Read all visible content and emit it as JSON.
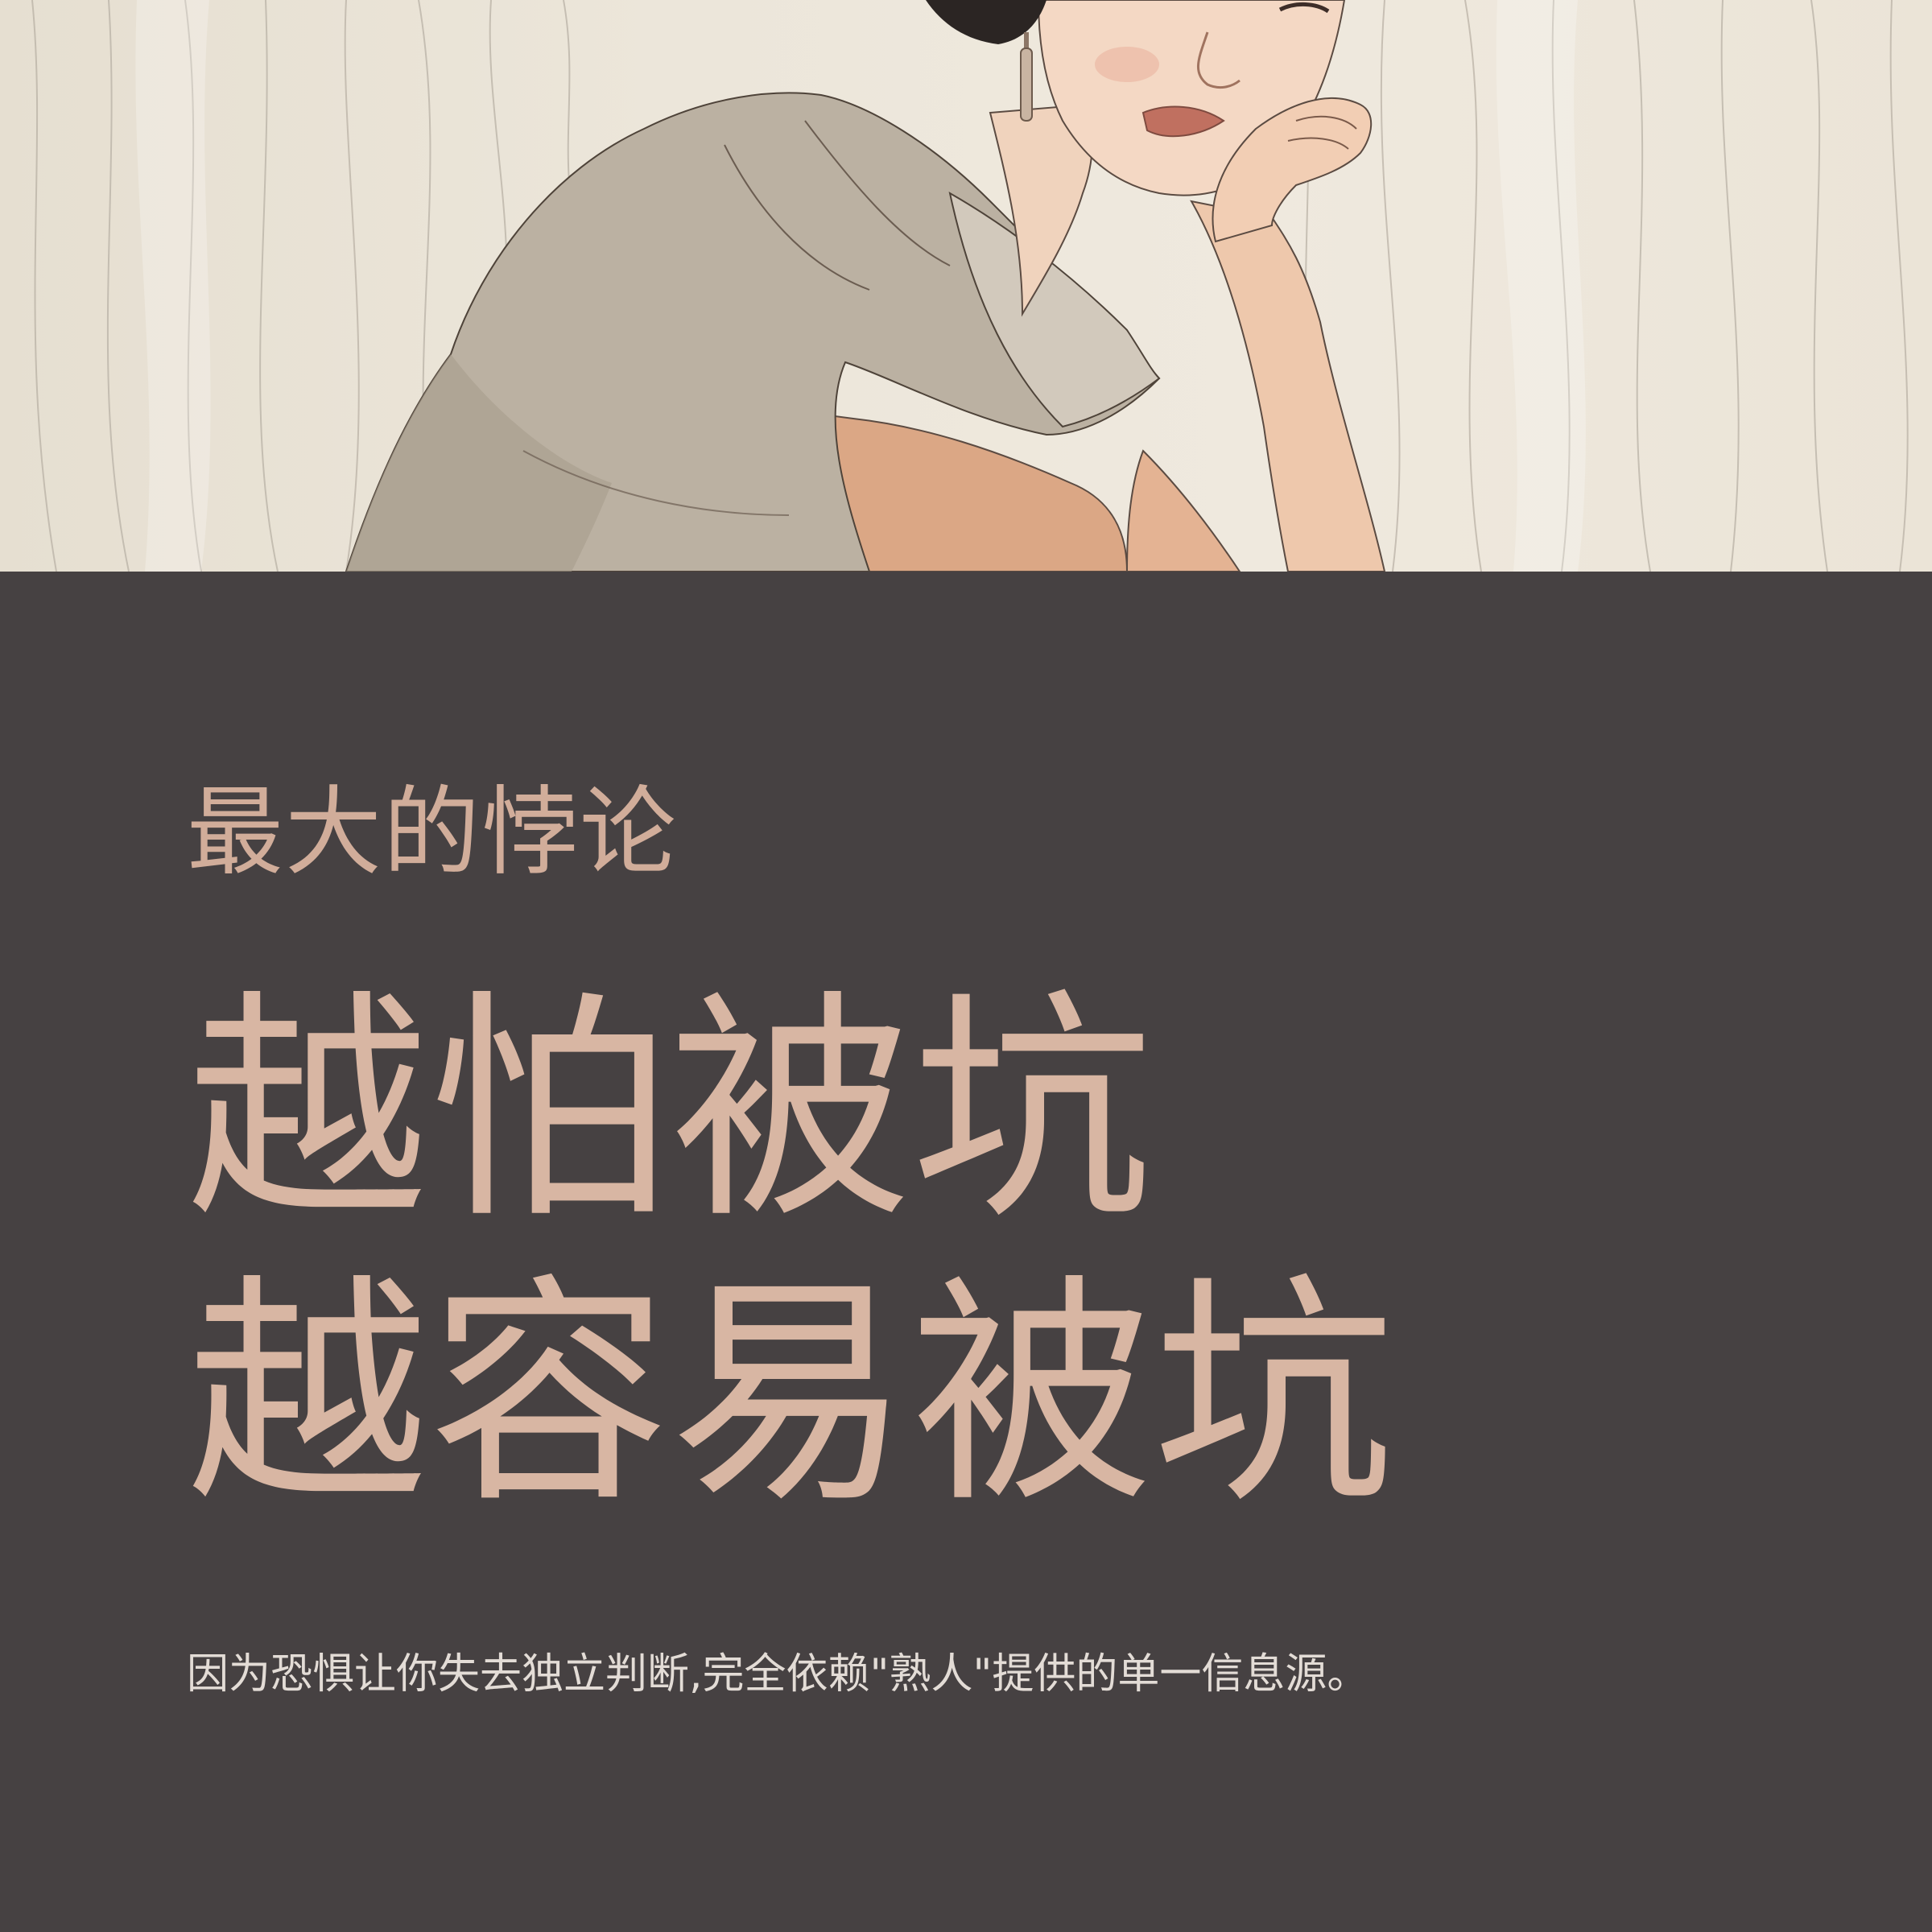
{
  "illustration": {
    "description_icon": "woman-resting-chin-illustration"
  },
  "text": {
    "kicker": "最大的悖论",
    "headline_line1": "越怕被坑",
    "headline_line2": "越容易被坑",
    "subtitle": "因为恐惧让你失去独立判断,完全依赖\"熟人\"提供的单一信息源。"
  },
  "colors": {
    "background": "#464142",
    "kicker": "#d1ad9a",
    "headline": "#d8b6a3",
    "subtitle": "#e3dcd6",
    "illustration_bg": "#ece6da"
  }
}
